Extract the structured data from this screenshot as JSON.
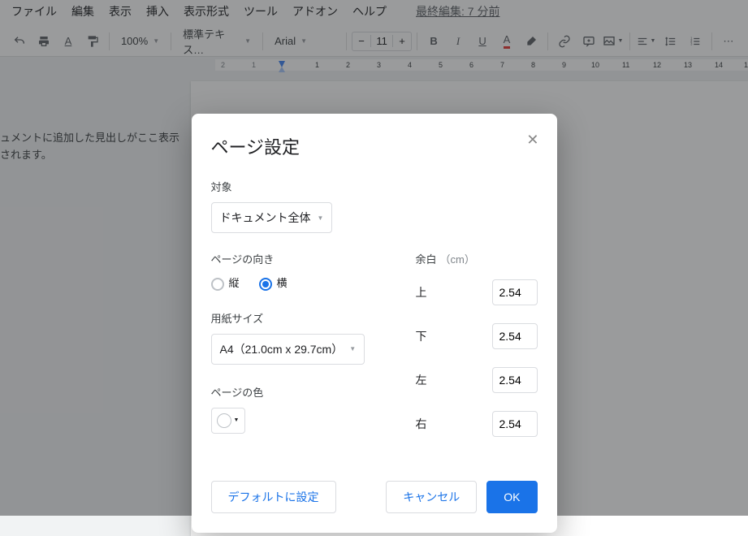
{
  "menu": {
    "file": "ファイル",
    "edit": "編集",
    "view": "表示",
    "insert": "挿入",
    "format": "表示形式",
    "tools": "ツール",
    "addons": "アドオン",
    "help": "ヘルプ",
    "lastEdit": "最終編集: 7 分前"
  },
  "toolbar": {
    "zoom": "100%",
    "style": "標準テキス…",
    "font": "Arial",
    "size": "11"
  },
  "outline": {
    "text": "ュメントに追加した見出しがここ表示されます。"
  },
  "dialog": {
    "title": "ページ設定",
    "targetLabel": "対象",
    "targetValue": "ドキュメント全体",
    "orientationLabel": "ページの向き",
    "orientPortrait": "縦",
    "orientLandscape": "横",
    "paperSizeLabel": "用紙サイズ",
    "paperSizeValue": "A4（21.0cm x 29.7cm）",
    "pageColorLabel": "ページの色",
    "marginLabel": "余白",
    "marginUnit": "（cm）",
    "margins": {
      "topLabel": "上",
      "topValue": "2.54",
      "bottomLabel": "下",
      "bottomValue": "2.54",
      "leftLabel": "左",
      "leftValue": "2.54",
      "rightLabel": "右",
      "rightValue": "2.54"
    },
    "btnDefault": "デフォルトに設定",
    "btnCancel": "キャンセル",
    "btnOk": "OK"
  }
}
